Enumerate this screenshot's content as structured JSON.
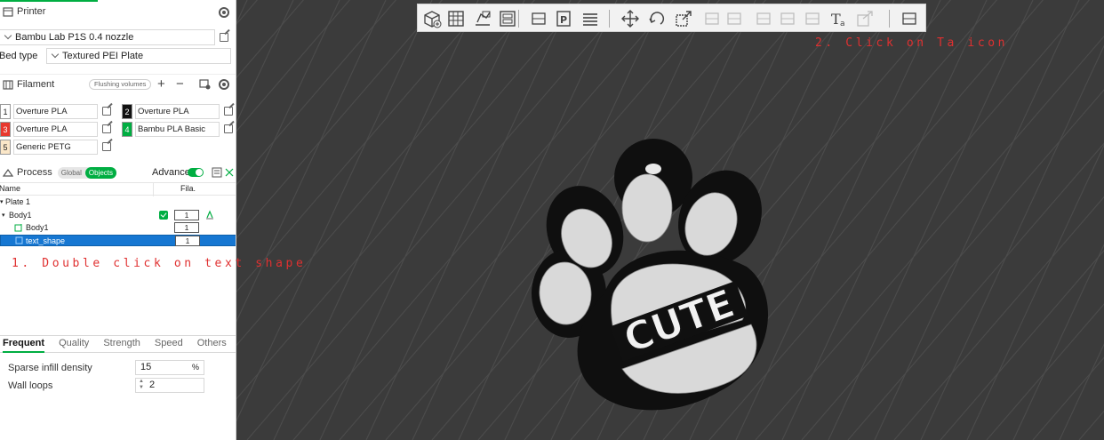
{
  "printer": {
    "title": "Printer",
    "preset": "Bambu Lab P1S 0.4 nozzle",
    "bed_type_label": "Bed type",
    "bed_type_value": "Textured PEI Plate"
  },
  "filament": {
    "title": "Filament",
    "flushing_label": "Flushing volumes",
    "plus": "+",
    "minus": "−",
    "items": [
      {
        "num": "1",
        "name": "Overture PLA",
        "color": "#ffffff",
        "text_color": "#222222"
      },
      {
        "num": "2",
        "name": "Overture PLA",
        "color": "#111111",
        "text_color": "#ffffff"
      },
      {
        "num": "3",
        "name": "Overture PLA",
        "color": "#e8382e",
        "text_color": "#ffffff"
      },
      {
        "num": "4",
        "name": "Bambu PLA Basic",
        "color": "#00ae42",
        "text_color": "#ffffff"
      },
      {
        "num": "5",
        "name": "Generic PETG",
        "color": "#fbe7c8",
        "text_color": "#222222"
      }
    ]
  },
  "process": {
    "title": "Process",
    "seg_global": "Global",
    "seg_objects": "Objects",
    "advance_label": "Advance"
  },
  "tree": {
    "col_name": "Name",
    "col_fila": "Fila.",
    "rows": [
      {
        "label": "Plate 1",
        "fila": ""
      },
      {
        "label": "Body1",
        "fila": "1"
      },
      {
        "label": "Body1",
        "fila": "1"
      },
      {
        "label": "text_shape",
        "fila": "1"
      }
    ]
  },
  "param_tabs": [
    "Frequent",
    "Quality",
    "Strength",
    "Speed",
    "Others"
  ],
  "params": {
    "infill_label": "Sparse infill density",
    "infill_value": "15",
    "infill_unit": "%",
    "walls_label": "Wall loops",
    "walls_value": "2"
  },
  "annotations": {
    "step1": "1. Double click on text shape",
    "step2": "2. Click on Ta icon"
  },
  "model": {
    "text": "CUTE"
  },
  "colors": {
    "accent": "#00ae42",
    "selection": "#1677d2",
    "annotation": "#e03030",
    "bed": "#3b3b3b"
  },
  "toolbar_icons": [
    "add-cube-icon",
    "grid-arrange-icon",
    "orient-icon",
    "split-plate-icon",
    "lay-flat-icon",
    "plate-p-icon",
    "layers-icon",
    "move-icon",
    "rotate-icon",
    "scale-icon",
    "cut-icon",
    "support-paint-icon",
    "seam-icon",
    "mesh-boolean-icon",
    "measure-icon",
    "text-ta-icon",
    "assembly-icon",
    "view-assembly-icon"
  ]
}
